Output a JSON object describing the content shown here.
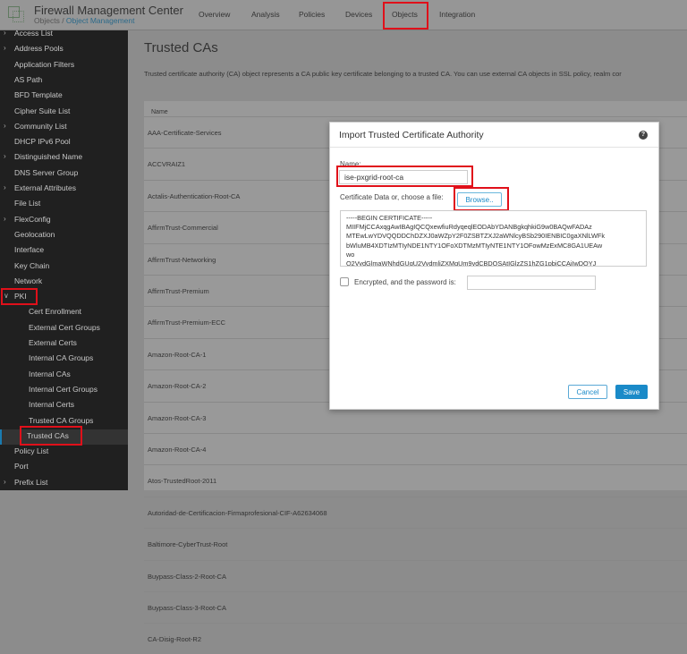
{
  "header": {
    "app_title": "Firewall Management Center",
    "breadcrumb_root": "Objects",
    "breadcrumb_sep": " / ",
    "breadcrumb_current": "Object Management",
    "nav": [
      {
        "label": "Overview"
      },
      {
        "label": "Analysis"
      },
      {
        "label": "Policies"
      },
      {
        "label": "Devices"
      },
      {
        "label": "Objects"
      },
      {
        "label": "Integration"
      }
    ],
    "active_nav": "Objects"
  },
  "sidebar": {
    "items": [
      {
        "label": "Access List",
        "expandable": true
      },
      {
        "label": "Address Pools",
        "expandable": true
      },
      {
        "label": "Application Filters"
      },
      {
        "label": "AS Path"
      },
      {
        "label": "BFD Template"
      },
      {
        "label": "Cipher Suite List"
      },
      {
        "label": "Community List",
        "expandable": true
      },
      {
        "label": "DHCP IPv6 Pool"
      },
      {
        "label": "Distinguished Name",
        "expandable": true
      },
      {
        "label": "DNS Server Group"
      },
      {
        "label": "External Attributes",
        "expandable": true
      },
      {
        "label": "File List"
      },
      {
        "label": "FlexConfig",
        "expandable": true
      },
      {
        "label": "Geolocation"
      },
      {
        "label": "Interface"
      },
      {
        "label": "Key Chain"
      },
      {
        "label": "Network"
      },
      {
        "label": "PKI",
        "expanded": true
      },
      {
        "label": "Cert Enrollment",
        "sub": true
      },
      {
        "label": "External Cert Groups",
        "sub": true
      },
      {
        "label": "External Certs",
        "sub": true
      },
      {
        "label": "Internal CA Groups",
        "sub": true
      },
      {
        "label": "Internal CAs",
        "sub": true
      },
      {
        "label": "Internal Cert Groups",
        "sub": true
      },
      {
        "label": "Internal Certs",
        "sub": true
      },
      {
        "label": "Trusted CA Groups",
        "sub": true
      },
      {
        "label": "Trusted CAs",
        "sub": true,
        "selected": true
      },
      {
        "label": "Policy List"
      },
      {
        "label": "Port"
      },
      {
        "label": "Prefix List",
        "expandable": true
      }
    ]
  },
  "main": {
    "title": "Trusted CAs",
    "description": "Trusted certificate authority (CA) object represents a CA public key certificate belonging to a trusted CA. You can use external CA objects in SSL policy, realm cor",
    "table": {
      "header": "Name",
      "rows": [
        "AAA-Certificate-Services",
        "ACCVRAIZ1",
        "Actalis-Authentication-Root-CA",
        "AffirmTrust-Commercial",
        "AffirmTrust-Networking",
        "AffirmTrust-Premium",
        "AffirmTrust-Premium-ECC",
        "Amazon-Root-CA-1",
        "Amazon-Root-CA-2",
        "Amazon-Root-CA-3",
        "Amazon-Root-CA-4",
        "Atos-TrustedRoot-2011",
        "Autoridad-de-Certificacion-Firmaprofesional-CIF-A62634068",
        "Baltimore-CyberTrust-Root",
        "Buypass-Class-2-Root-CA",
        "Buypass-Class-3-Root-CA",
        "CA-Disig-Root-R2"
      ]
    }
  },
  "modal": {
    "title": "Import Trusted Certificate Authority",
    "help_icon": "?",
    "name_label": "Name:",
    "name_value": "ise-pxgrid-root-ca",
    "cert_label": "Certificate Data or, choose a file:",
    "browse_label": "Browse..",
    "cert_lines": [
      "-----BEGIN CERTIFICATE-----",
      "MIIFMjCCAxqgAwIBAgIQCQxewfiuRdyqeqlEODAbYDANBgkqhkiG9w0BAQwFADAz",
      "MTEwLwYDVQQDDChDZXJ0aWZpY2F0ZSBTZXJ2aWNlcyBSb290IENBIC0gaXNlLWFk",
      "bWluMB4XDTIzMTIyNDE1NTY1OFoXDTMzMTIyNTE1NTY1OFowMzExMC8GA1UEAw",
      "wo",
      "Q2VydGlmaWNhdGUgU2VydmljZXMgUm9vdCBDQSAtIGlzZS1hZG1pbjCCAiIwDQYJ"
    ],
    "encrypted_label": "Encrypted, and the password is:",
    "encrypted_checked": false,
    "password_value": "",
    "cancel_label": "Cancel",
    "save_label": "Save"
  },
  "colors": {
    "accent": "#1a8ac8",
    "highlight": "#e0101a",
    "sidebar_bg": "#202020"
  }
}
